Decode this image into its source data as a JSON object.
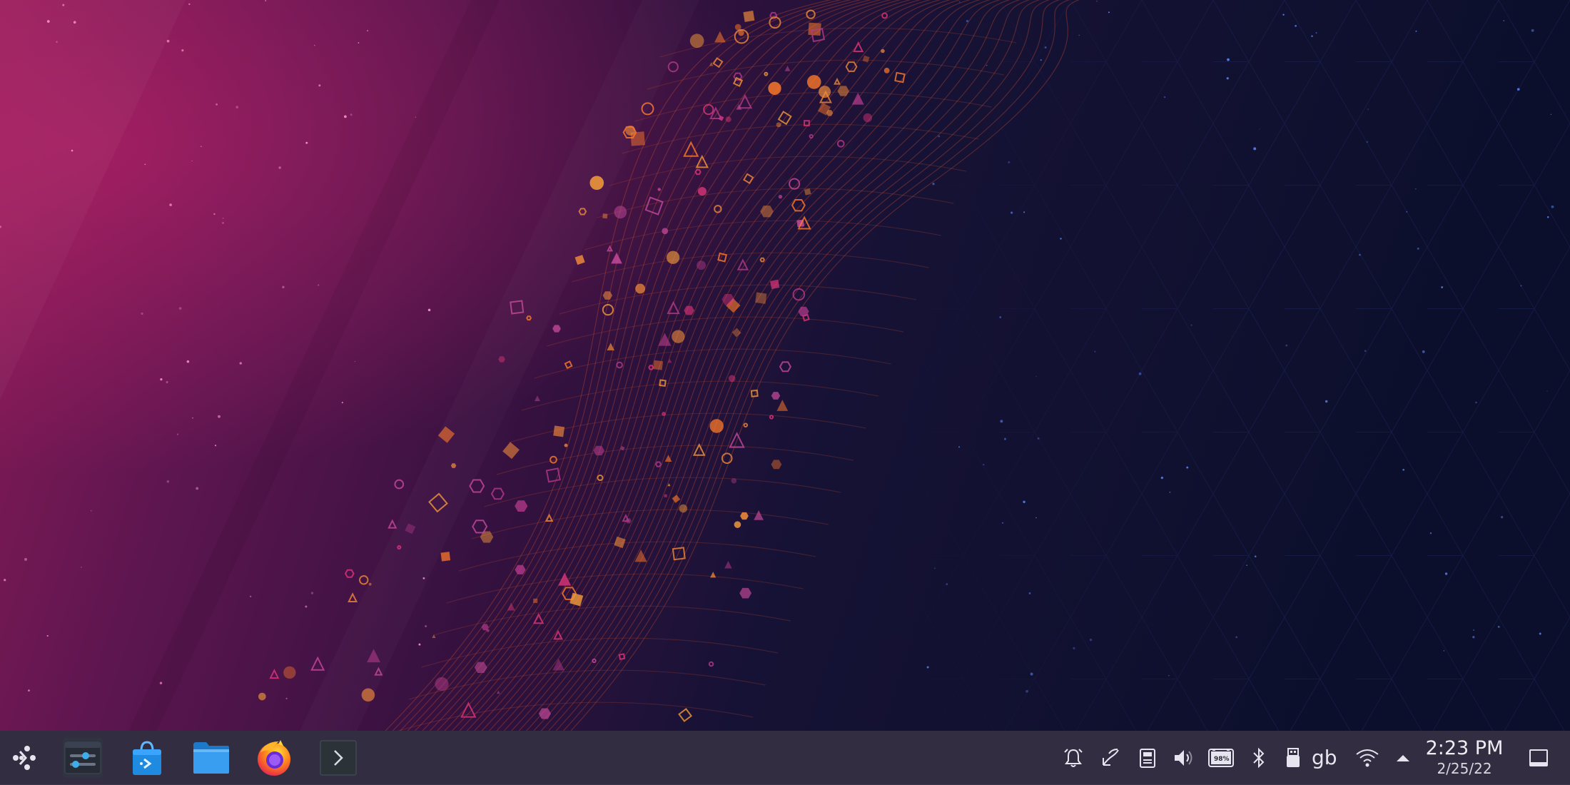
{
  "desktop": {
    "wallpaper": "abstract-particle-wave",
    "colors": {
      "left": "#8a1a55",
      "mid": "#3a1345",
      "right": "#0d1030",
      "accent_orange": "#f08a3a",
      "accent_pink": "#e0357a"
    }
  },
  "taskbar": {
    "launchers": [
      {
        "name": "application-launcher",
        "icon": "steamdeck-launcher-icon"
      },
      {
        "name": "system-settings",
        "icon": "settings-sliders-icon"
      },
      {
        "name": "discover-store",
        "icon": "shopping-bag-icon"
      },
      {
        "name": "dolphin-file-manager",
        "icon": "folder-icon"
      },
      {
        "name": "firefox",
        "icon": "firefox-icon"
      },
      {
        "name": "konsole-terminal",
        "icon": "terminal-icon"
      }
    ],
    "tray": {
      "icons": [
        "notifications-icon",
        "clipboard-icon",
        "storage-icon",
        "volume-icon",
        "battery-icon",
        "bluetooth-icon",
        "usb-device-icon",
        "network-wifi-icon",
        "expand-tray-icon"
      ],
      "battery_label": "98%",
      "keyboard_layout": "gb"
    },
    "clock": {
      "time": "2:23 PM",
      "date": "2/25/22"
    },
    "show_desktop": "show-desktop-icon"
  }
}
